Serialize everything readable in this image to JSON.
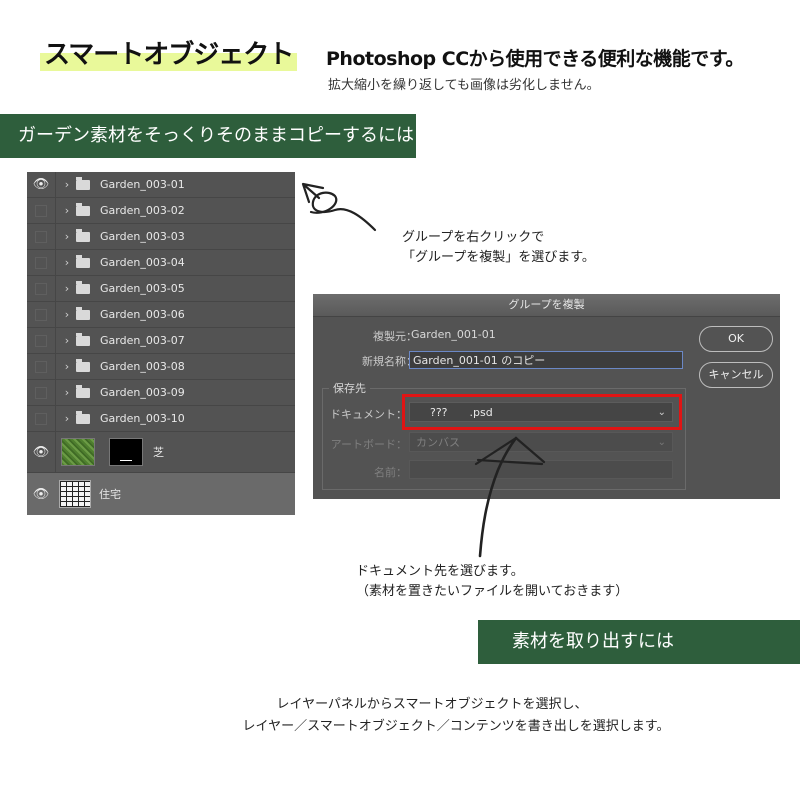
{
  "header": {
    "title": "スマートオブジェクト",
    "subtitle": "Photoshop CCから使用できる便利な機能です。",
    "note": "拡大縮小を繰り返しても画像は劣化しません。"
  },
  "section1": {
    "heading": "ガーデン素材をそっくりそのままコピーするには"
  },
  "layers_panel": {
    "groups": [
      {
        "name": "Garden_003-01",
        "visible": true
      },
      {
        "name": "Garden_003-02",
        "visible": false
      },
      {
        "name": "Garden_003-03",
        "visible": false
      },
      {
        "name": "Garden_003-04",
        "visible": false
      },
      {
        "name": "Garden_003-05",
        "visible": false
      },
      {
        "name": "Garden_003-06",
        "visible": false
      },
      {
        "name": "Garden_003-07",
        "visible": false
      },
      {
        "name": "Garden_003-08",
        "visible": false
      },
      {
        "name": "Garden_003-09",
        "visible": false
      },
      {
        "name": "Garden_003-10",
        "visible": false
      }
    ],
    "grass_layer": "芝",
    "house_layer": "住宅"
  },
  "annotations": {
    "right_click_line1": "グループを右クリックで",
    "right_click_line2": "「グループを複製」を選びます。",
    "doc_line1": "ドキュメント先を選びます。",
    "doc_line2": "（素材を置きたいファイルを開いておきます）"
  },
  "dialog": {
    "title": "グループを複製",
    "source_label": "複製元：",
    "source_value": "Garden_001-01",
    "newname_label": "新規名称：",
    "newname_value": "Garden_001-01 のコピー",
    "destination_label": "保存先",
    "document_label": "ドキュメント：",
    "document_value": "???　　.psd",
    "artboard_label": "アートボード：",
    "artboard_value": "カンバス",
    "name_label": "名前：",
    "name_value": "",
    "ok": "OK",
    "cancel": "キャンセル"
  },
  "section2": {
    "heading": "素材を取り出すには",
    "line1": "レイヤーパネルからスマートオブジェクトを選択し、",
    "line2": "レイヤー／スマートオブジェクト／コンテンツを書き出しを選択します。"
  },
  "colors": {
    "accent_green": "#2e5e3c",
    "highlight": "#e9f99a",
    "alert_red": "#e01414"
  }
}
